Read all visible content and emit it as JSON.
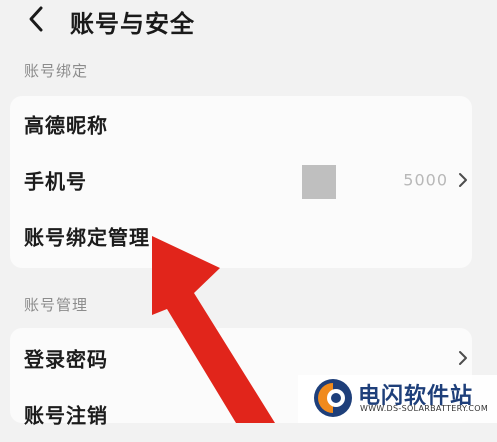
{
  "header": {
    "title": "账号与安全",
    "back_icon": "chevron-left-icon"
  },
  "sections": [
    {
      "label": "账号绑定",
      "items": [
        {
          "label": "高德昵称",
          "value": "",
          "chevron": false
        },
        {
          "label": "手机号",
          "value": "5000",
          "chevron": true
        },
        {
          "label": "账号绑定管理",
          "value": "",
          "chevron": false
        }
      ]
    },
    {
      "label": "账号管理",
      "items": [
        {
          "label": "登录密码",
          "value": "",
          "chevron": true
        },
        {
          "label": "账号注销",
          "value": "",
          "chevron": false
        }
      ]
    }
  ],
  "annotation": {
    "arrow_color": "#e1251b",
    "arrow_icon": "red-arrow-icon"
  },
  "watermark": {
    "name": "电闪软件站",
    "url": "WWW.DS-SOLARBATTERY.COM",
    "logo_icon": "ds-logo-icon",
    "colors": [
      "#1e3f7a",
      "#f08a1c"
    ]
  },
  "colors": {
    "background": "#f2f2f2",
    "card": "#fbfbfb",
    "section_label": "#8c8c8c"
  }
}
